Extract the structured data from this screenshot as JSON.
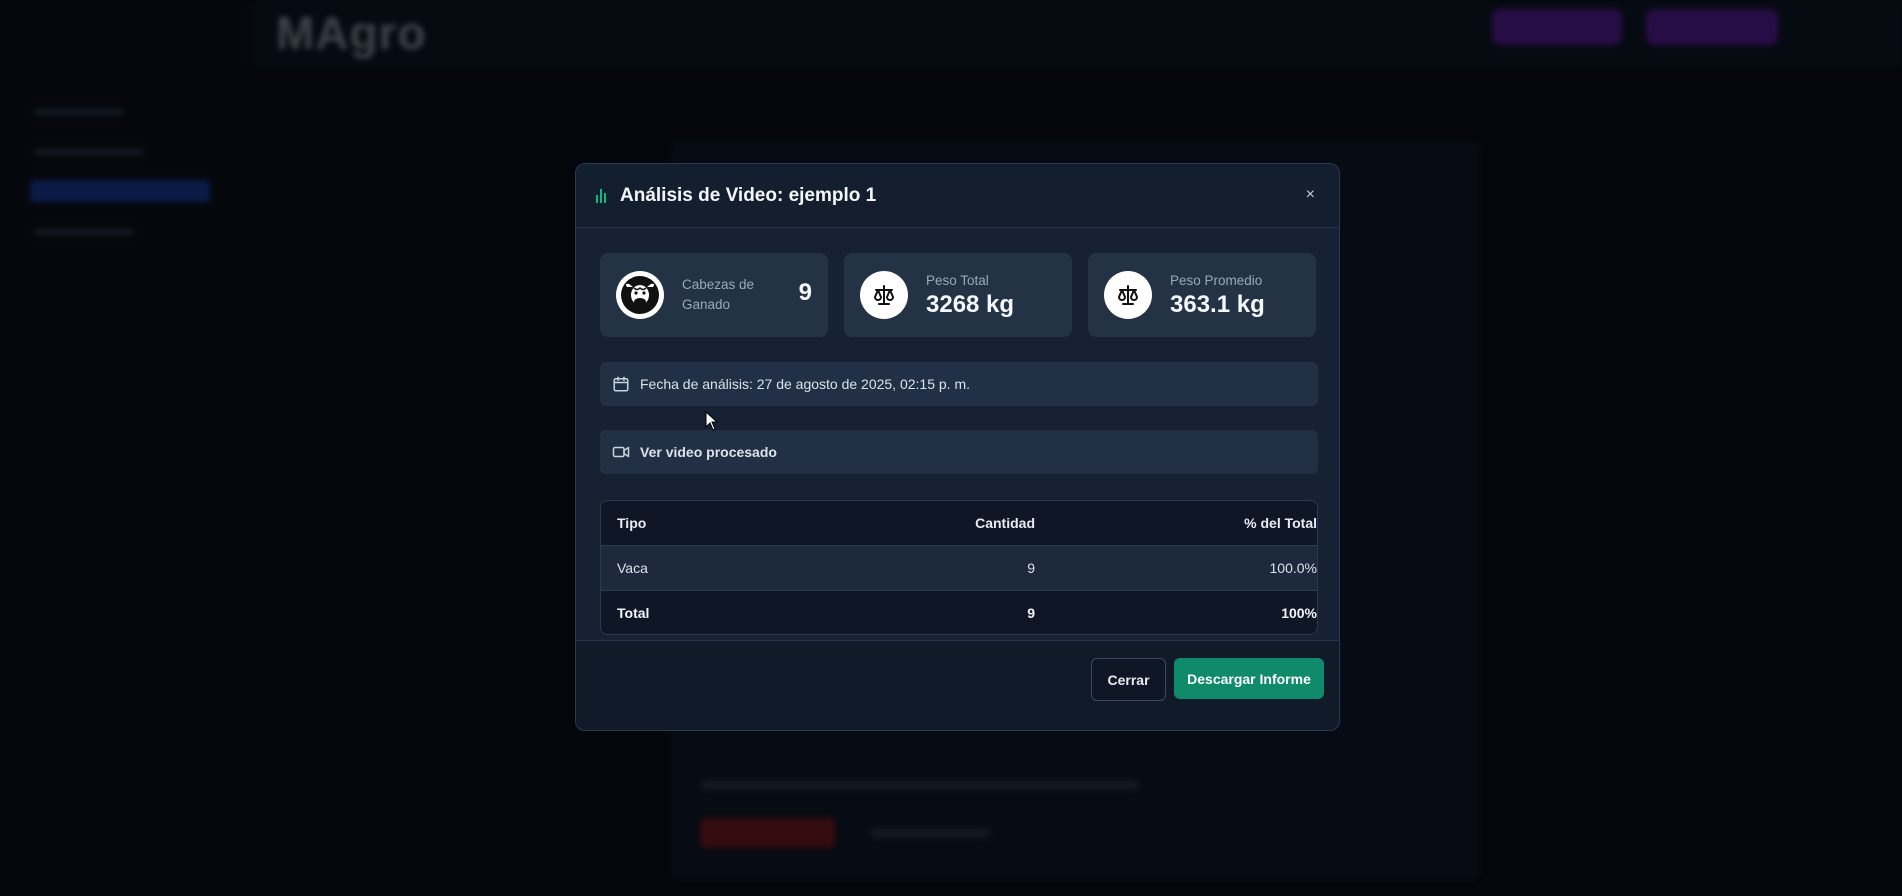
{
  "background": {
    "logo_text": "MAgro"
  },
  "modal": {
    "title": "Análisis de Video: ejemplo 1",
    "close_glyph": "×",
    "stats": {
      "cattle": {
        "label": "Cabezas de Ganado",
        "value": "9"
      },
      "total_weight": {
        "label": "Peso Total",
        "value": "3268 kg"
      },
      "avg_weight": {
        "label": "Peso Promedio",
        "value": "363.1 kg"
      }
    },
    "analysis_date": "Fecha de análisis: 27 de agosto de 2025, 02:15 p. m.",
    "video_link": "Ver video procesado",
    "table": {
      "headers": [
        "Tipo",
        "Cantidad",
        "% del Total"
      ],
      "rows": [
        [
          "Vaca",
          "9",
          "100.0%"
        ]
      ],
      "total": [
        "Total",
        "9",
        "100%"
      ]
    },
    "footer": {
      "close_label": "Cerrar",
      "download_label": "Descargar Informe"
    }
  },
  "colors": {
    "accent_green": "#10b981",
    "download_button": "#0f8a6a",
    "top_buttons": "#7b1fd1"
  }
}
